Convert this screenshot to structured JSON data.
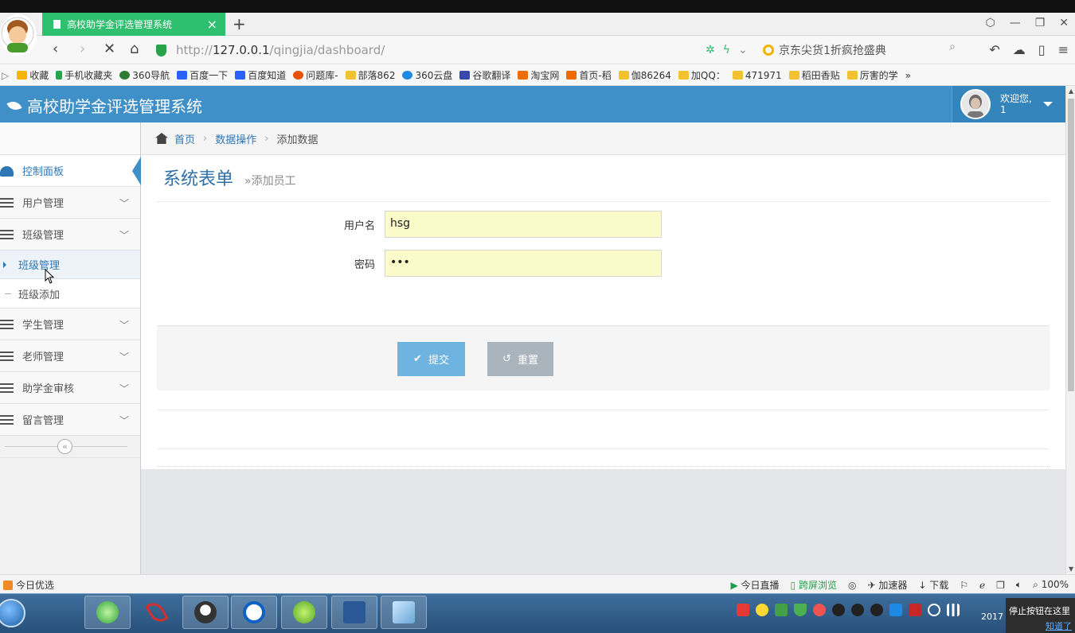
{
  "browser": {
    "tab_title": "高校助学金评选管理系统",
    "new_tab": "+",
    "url_prefix": "http://",
    "url_host": "127.0.0.1",
    "url_path": "/qingjia/dashboard/",
    "search_text": "京东尖货1折疯抢盛典",
    "bookmarks": [
      "收藏",
      "手机收藏夹",
      "360导航",
      "百度一下",
      "百度知道",
      "问题库-",
      "部落862",
      "360云盘",
      "谷歌翻译",
      "淘宝网",
      "首页-稻",
      "伽86264",
      "加QQ：",
      "471971",
      "稻田香贴",
      "厉害的学"
    ],
    "more": "»"
  },
  "app": {
    "title": "高校助学金评选管理系统",
    "welcome": "欢迎您,",
    "username": "1"
  },
  "sidebar": {
    "items": [
      {
        "label": "控制面板"
      },
      {
        "label": "用户管理"
      },
      {
        "label": "班级管理"
      },
      {
        "label": "学生管理"
      },
      {
        "label": "老师管理"
      },
      {
        "label": "助学金审核"
      },
      {
        "label": "留言管理"
      }
    ],
    "subitems": [
      {
        "label": "班级管理"
      },
      {
        "label": "班级添加"
      }
    ],
    "collapse": "«"
  },
  "breadcrumb": {
    "home": "首页",
    "data_ops": "数据操作",
    "current": "添加数据"
  },
  "page": {
    "title": "系统表单",
    "subtitle": "添加员工",
    "fields": {
      "username_label": "用户名",
      "username_value": "hsg",
      "password_label": "密码",
      "password_value": "•••"
    },
    "submit_label": "提交",
    "reset_label": "重置"
  },
  "statusbar": {
    "left": "今日优选",
    "live": "今日直播",
    "cross_screen": "跨屏浏览",
    "accelerator": "加速器",
    "download": "下载",
    "zoom": "100%"
  },
  "taskbar": {
    "clock": "2017",
    "tooltip": "停止按钮在这里",
    "tooltip_link": "知道了"
  },
  "colors": {
    "header_blue": "#3f8fc8",
    "tab_green": "#2ebf6f",
    "link_blue": "#2f76b5",
    "input_yellow": "#fafbc8",
    "submit_blue": "#6fb3e0",
    "reset_gray": "#a9b4bd"
  }
}
